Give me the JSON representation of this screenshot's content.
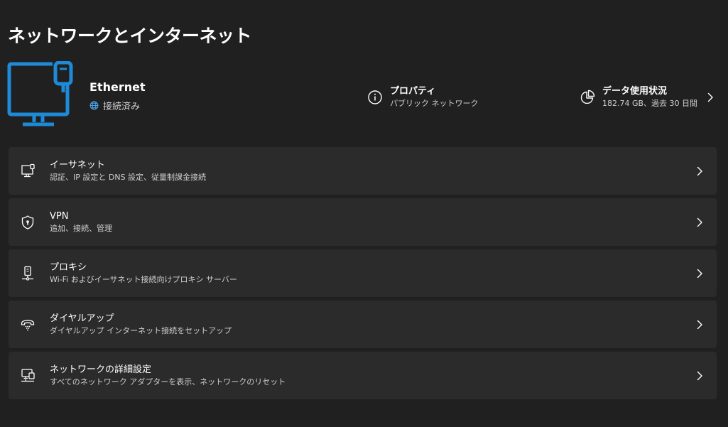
{
  "page": {
    "title": "ネットワークとインターネット"
  },
  "header": {
    "adapter_name": "Ethernet",
    "status": "接続済み",
    "properties": {
      "title": "プロパティ",
      "subtitle": "パブリック ネットワーク"
    },
    "data_usage": {
      "title": "データ使用状況",
      "subtitle": "182.74 GB、過去 30 日間"
    }
  },
  "cards": [
    {
      "title": "イーサネット",
      "subtitle": "認証、IP 設定と DNS 設定、従量制課金接続"
    },
    {
      "title": "VPN",
      "subtitle": "追加、接続、管理"
    },
    {
      "title": "プロキシ",
      "subtitle": "Wi-Fi およびイーサネット接続向けプロキシ サーバー"
    },
    {
      "title": "ダイヤルアップ",
      "subtitle": "ダイヤルアップ インターネット接続をセットアップ"
    },
    {
      "title": "ネットワークの詳細設定",
      "subtitle": "すべてのネットワーク アダプターを表示、ネットワークのリセット"
    }
  ],
  "colors": {
    "background": "#202020",
    "card": "#2b2b2b",
    "accent": "#1e8ad8"
  },
  "icons": {
    "hero": "ethernet-monitor-icon",
    "status": "globe-icon",
    "properties": "info-icon",
    "data_usage": "pie-chart-icon",
    "ethernet": "ethernet-icon",
    "vpn": "shield-icon",
    "proxy": "proxy-server-icon",
    "dialup": "dialup-phone-icon",
    "advanced": "network-computer-icon",
    "chevron": "chevron-right-icon"
  }
}
